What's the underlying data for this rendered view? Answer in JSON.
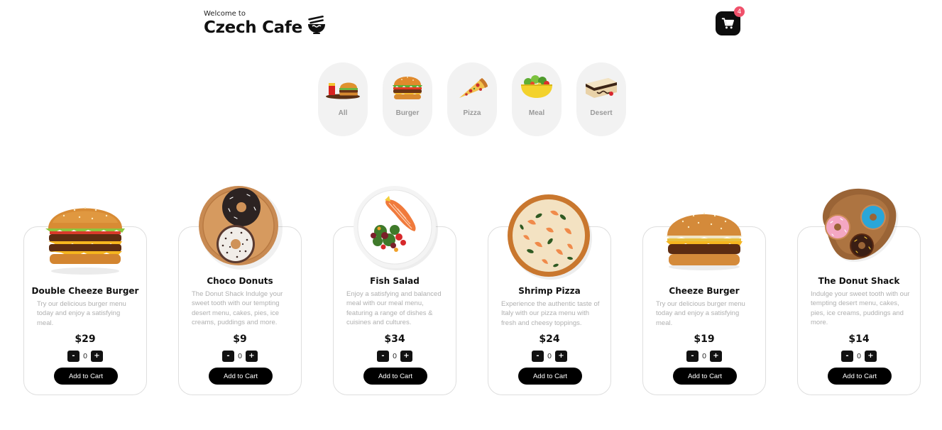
{
  "header": {
    "welcome": "Welcome to",
    "title": "Czech Cafe",
    "cart_count": "4"
  },
  "categories": [
    {
      "label": "All",
      "icon": "burger-meal-icon"
    },
    {
      "label": "Burger",
      "icon": "burger-icon"
    },
    {
      "label": "Pizza",
      "icon": "pizza-slice-icon"
    },
    {
      "label": "Meal",
      "icon": "salad-bowl-icon"
    },
    {
      "label": "Desert",
      "icon": "cake-slice-icon"
    }
  ],
  "products": [
    {
      "title": "Double Cheeze Burger",
      "desc": "Try our delicious burger menu today and enjoy a satisfying meal.",
      "price": "$29",
      "qty": "0",
      "minus": "-",
      "plus": "+",
      "button": "Add to Cart"
    },
    {
      "title": "Choco Donuts",
      "desc": "The Donut Shack Indulge your sweet tooth with our tempting desert menu, cakes, pies, ice creams, puddings and more.",
      "price": "$9",
      "qty": "0",
      "minus": "-",
      "plus": "+",
      "button": "Add to Cart"
    },
    {
      "title": "Fish Salad",
      "desc": "Enjoy a satisfying and balanced meal with our meal menu, featuring a range of dishes & cuisines and cultures.",
      "price": "$34",
      "qty": "0",
      "minus": "-",
      "plus": "+",
      "button": "Add to Cart"
    },
    {
      "title": "Shrimp Pizza",
      "desc": "Experience the authentic taste of Italy with our pizza menu with fresh and cheesy toppings.",
      "price": "$24",
      "qty": "0",
      "minus": "-",
      "plus": "+",
      "button": "Add to Cart"
    },
    {
      "title": "Cheeze Burger",
      "desc": "Try our delicious burger menu today and enjoy a satisfying meal.",
      "price": "$19",
      "qty": "0",
      "minus": "-",
      "plus": "+",
      "button": "Add to Cart"
    },
    {
      "title": "The Donut Shack",
      "desc": "Indulge your sweet tooth with our tempting desert menu, cakes, pies, ice creams, puddings and more.",
      "price": "$14",
      "qty": "0",
      "minus": "-",
      "plus": "+",
      "button": "Add to Cart"
    }
  ],
  "colors": {
    "accent": "#000000",
    "badge": "#f0516b",
    "category_bg": "#f2f2f2",
    "muted_text": "#b0b0b0"
  }
}
